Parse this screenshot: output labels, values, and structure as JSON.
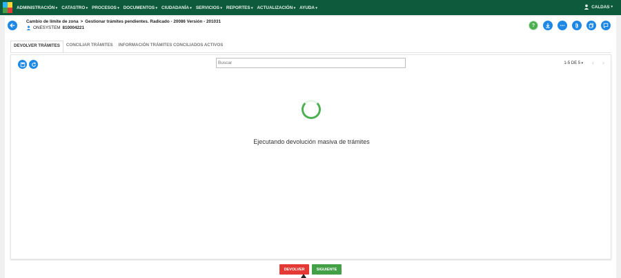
{
  "navbar": {
    "menu": [
      "ADMINISTRACIÓN",
      "CATASTRO",
      "PROCESOS",
      "DOCUMENTOS",
      "CIUDADANÍA",
      "SERVICIOS",
      "REPORTES",
      "ACTUALIZACIÓN",
      "AYUDA"
    ],
    "user": "CALDAS"
  },
  "header": {
    "crumb1": "Cambio de límite de zona",
    "crumb_sep": ">",
    "crumb2": "Gestionar trámites pendientes. Radicado - 20086 Versión - 201031",
    "owner_name": "ONESYSTEM",
    "owner_id": "810004221"
  },
  "tabs": [
    "DEVOLVER TRÁMITES",
    "CONCILIAR TRÁMITES",
    "INFORMACIÓN TRÁMITES CONCILIADOS ACTIVOS"
  ],
  "search": {
    "placeholder": "Buscar"
  },
  "pager": {
    "label": "1-5 DE 5"
  },
  "status": {
    "message": "Ejecutando devolución masiva de trámites"
  },
  "footer": {
    "return_label": "DEVOLVER",
    "next_label": "SIGUIENTE"
  },
  "colors": {
    "navbar": "#0e5a3c",
    "primary": "#1e88e5",
    "success": "#43a047",
    "danger": "#e53935"
  }
}
